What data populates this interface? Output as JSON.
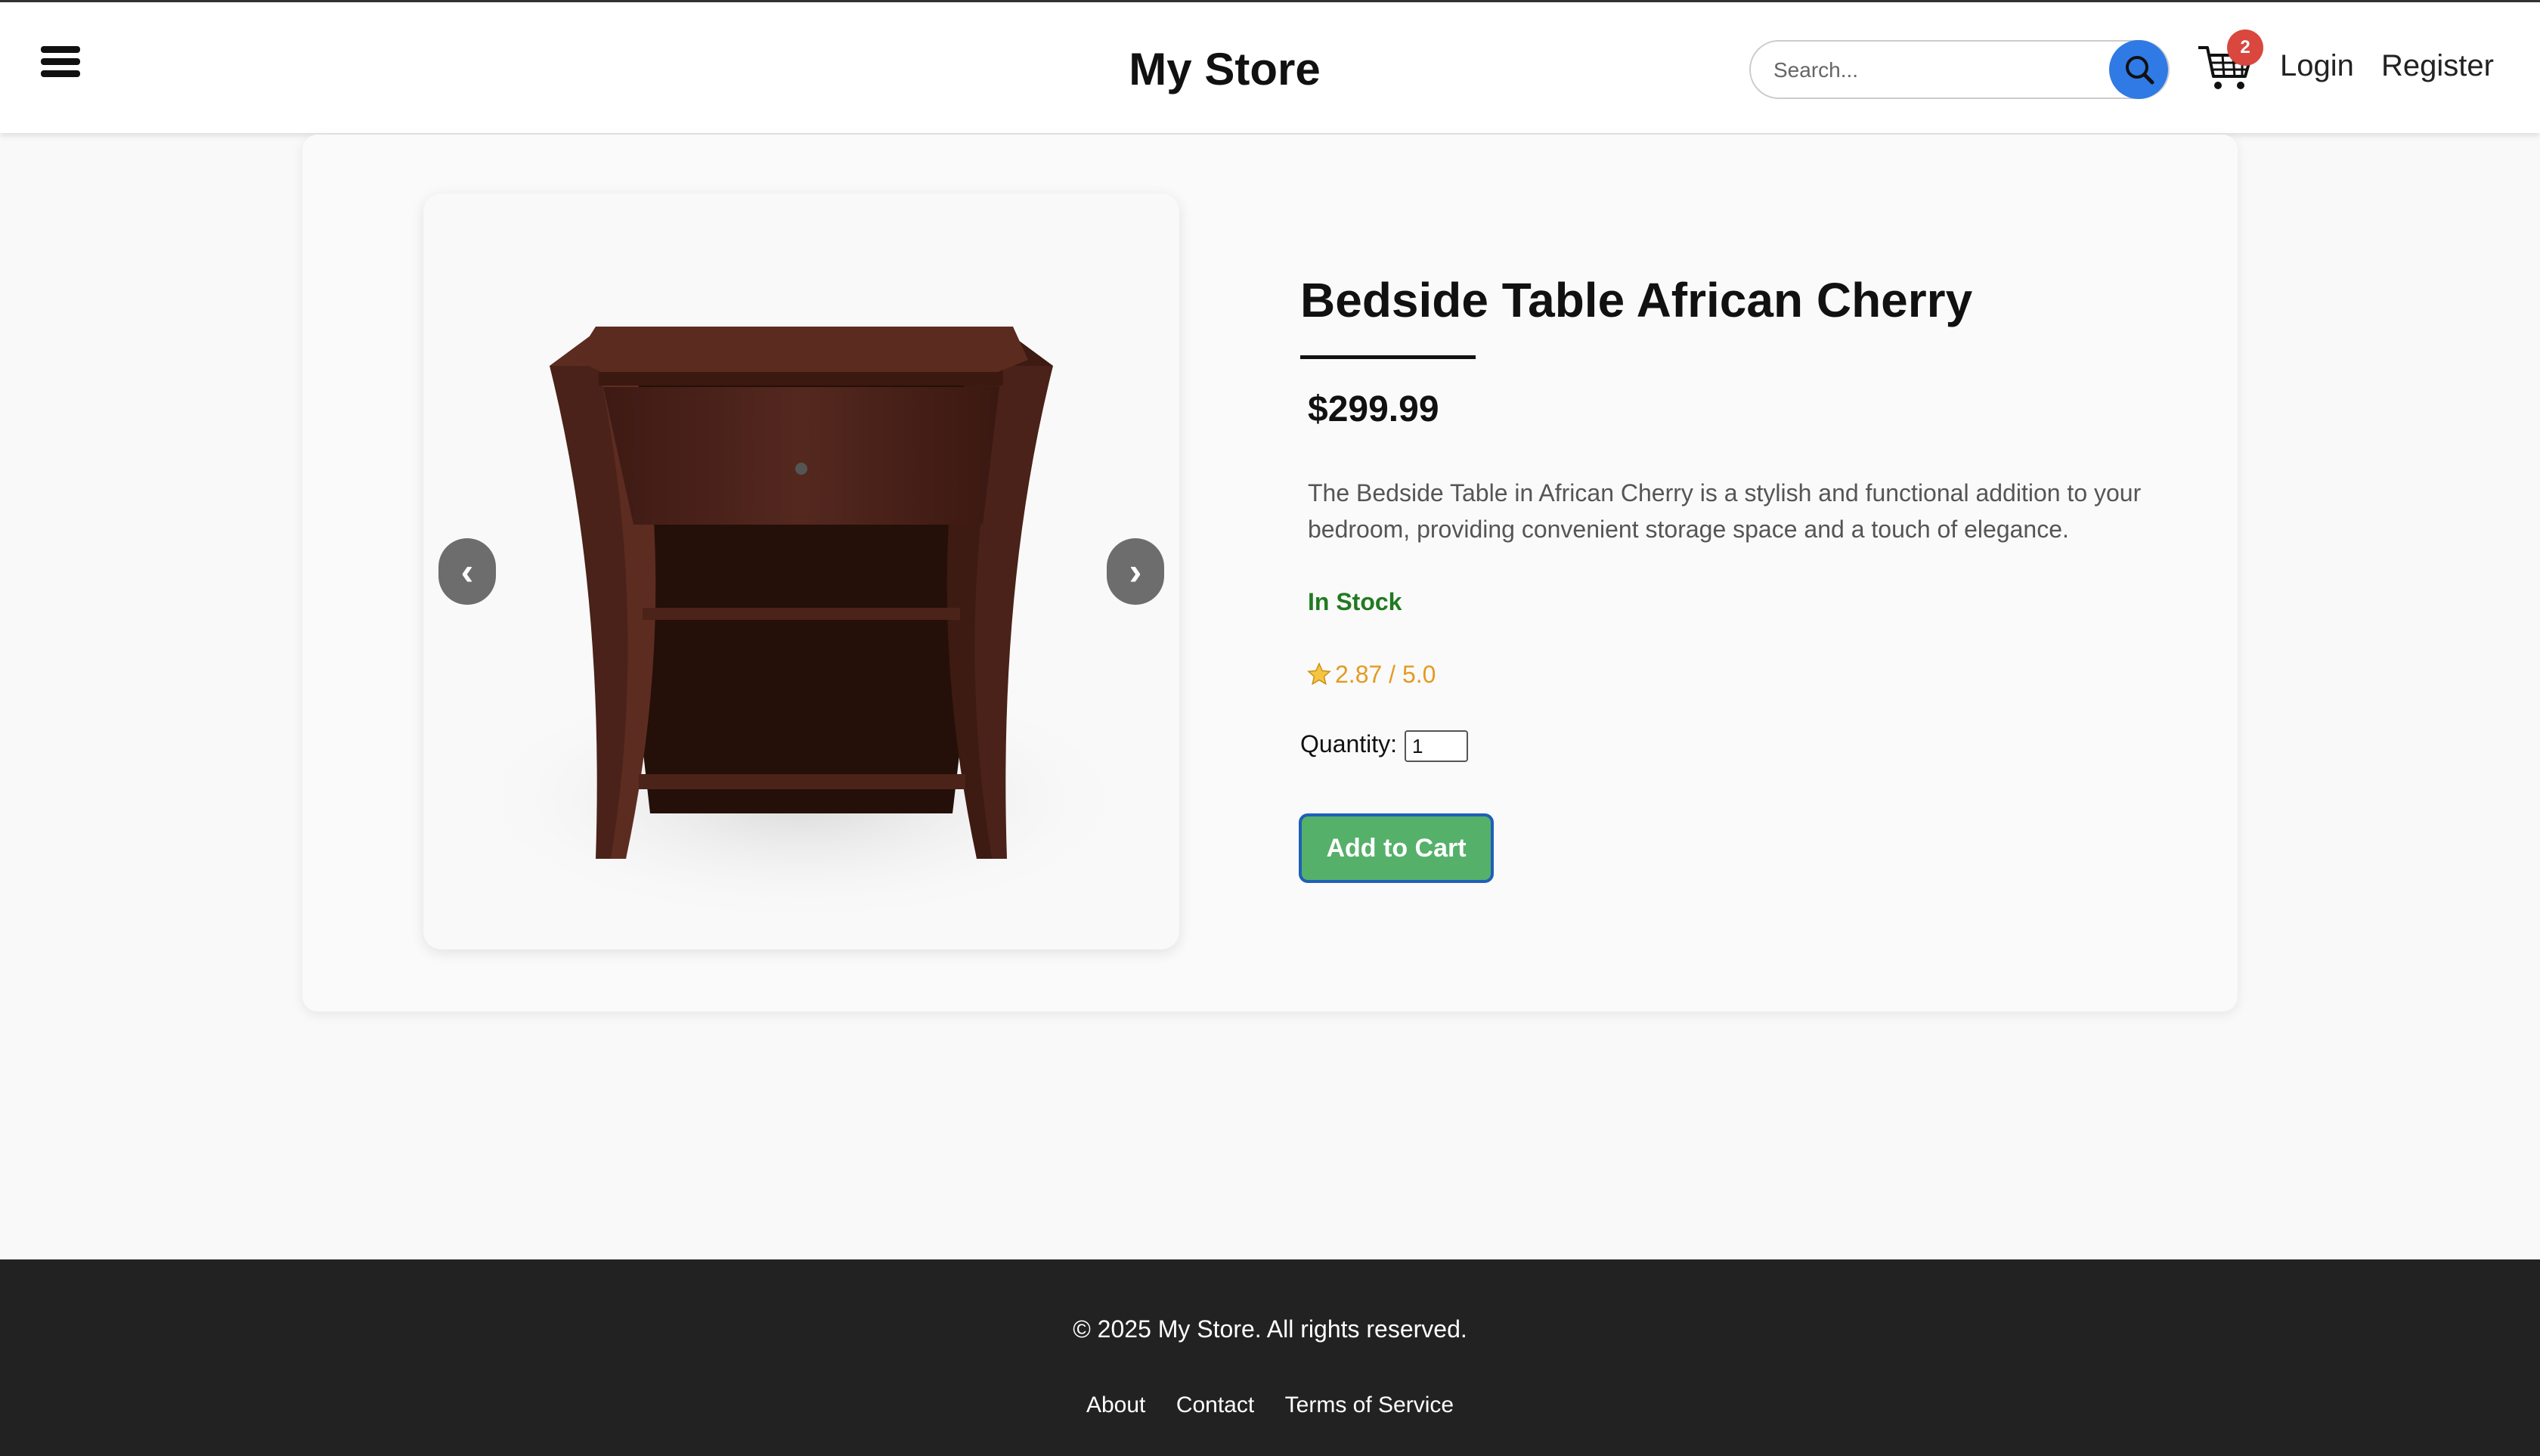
{
  "header": {
    "menu_icon": "hamburger-menu-icon",
    "title": "My Store",
    "search": {
      "placeholder": "Search...",
      "value": "",
      "button_icon": "search-icon"
    },
    "cart": {
      "icon": "shopping-cart-icon",
      "count": "2"
    },
    "nav": {
      "login": "Login",
      "register": "Register"
    }
  },
  "product": {
    "name": "Bedside Table African Cherry",
    "price": "$299.99",
    "description": "The Bedside Table in African Cherry is a stylish and functional addition to your bedroom, providing convenient storage space and a touch of elegance.",
    "stock_status": "In Stock",
    "rating_icon": "star-icon",
    "rating": "2.87 / 5.0",
    "quantity_label": "Quantity:",
    "quantity_value": "1",
    "add_to_cart_label": "Add to Cart",
    "carousel": {
      "prev": "‹",
      "next": "›"
    }
  },
  "footer": {
    "copyright": "© 2025 My Store. All rights reserved.",
    "links": [
      "About",
      "Contact",
      "Terms of Service"
    ]
  },
  "colors": {
    "accent_blue": "#2f7ae5",
    "badge_red": "#d9473f",
    "stock_green": "#217a21",
    "rating_orange": "#e59a1f",
    "button_green": "#55b06a",
    "footer_bg": "#222222"
  }
}
